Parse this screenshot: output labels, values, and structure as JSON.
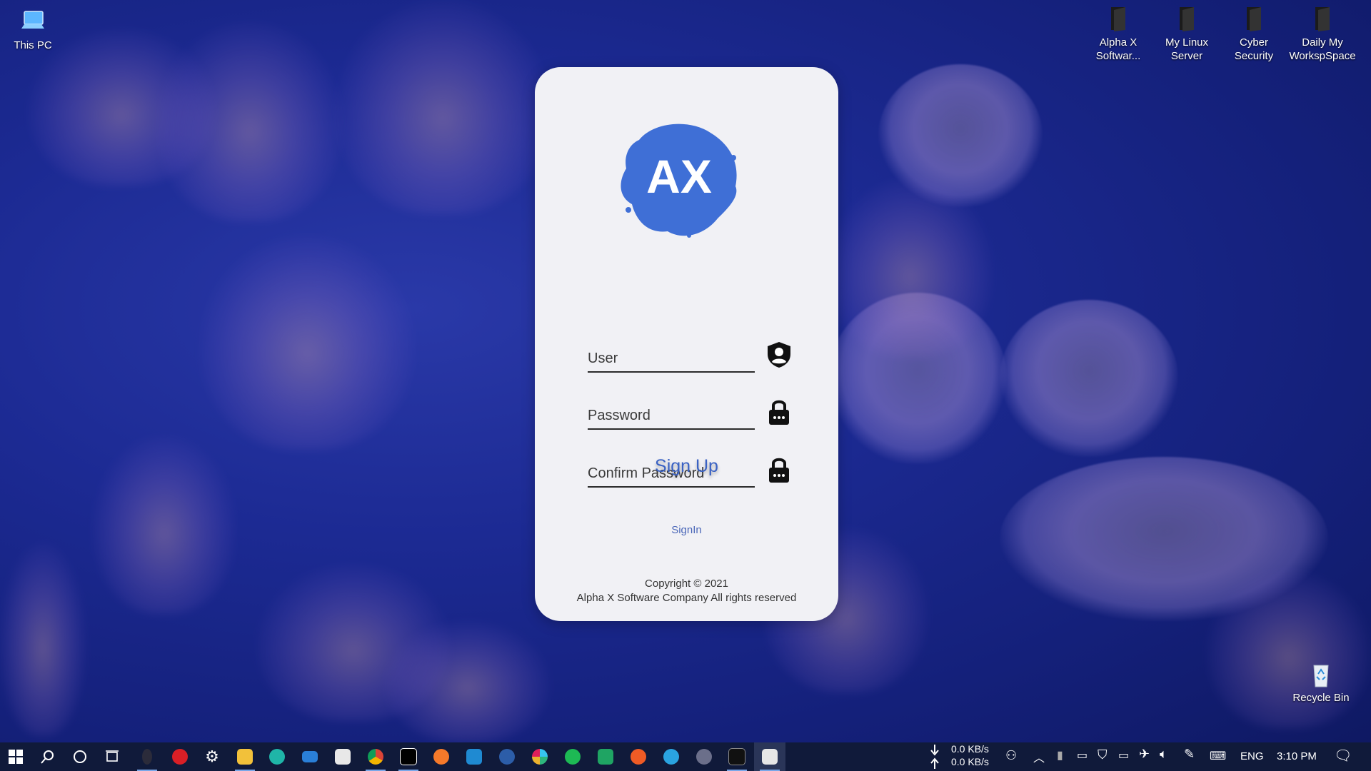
{
  "desktop": {
    "left_icons": [
      {
        "name": "this-pc",
        "label": "This PC"
      }
    ],
    "right_icons": [
      {
        "name": "alpha-x-software",
        "label": "Alpha X Softwar..."
      },
      {
        "name": "my-linux-server",
        "label": "My Linux Server"
      },
      {
        "name": "cyber-security",
        "label": "Cyber Security"
      },
      {
        "name": "daily-my-workspace",
        "label": "Daily My WorkspSpace"
      }
    ],
    "recycle_bin": {
      "label": "Recycle Bin"
    }
  },
  "signup": {
    "logo_text": "AX",
    "fields": [
      {
        "placeholder": "User",
        "icon": "user-shield-icon"
      },
      {
        "placeholder": "Password",
        "icon": "lock-icon"
      },
      {
        "placeholder": "Confirm Password",
        "icon": "lock-icon"
      }
    ],
    "submit_label": "Sign Up",
    "signin_link": "SignIn",
    "copyright_line1": "Copyright © 2021",
    "copyright_line2": "Alpha X Software Company All rights reserved",
    "accent_color": "#3a62c4",
    "logo_color": "#3f6fd6"
  },
  "taskbar": {
    "net_down": "0.0 KB/s",
    "net_up": "0.0 KB/s",
    "language": "ENG",
    "time": "3:10 PM",
    "apps": [
      "tor-browser",
      "antivirus",
      "settings",
      "file-explorer",
      "edge",
      "mail",
      "store",
      "chrome",
      "intellij",
      "blender",
      "vscode",
      "wps",
      "slack",
      "spotify",
      "libreoffice-calc",
      "postman",
      "telegram",
      "obs",
      "terminal",
      "java-app"
    ]
  }
}
